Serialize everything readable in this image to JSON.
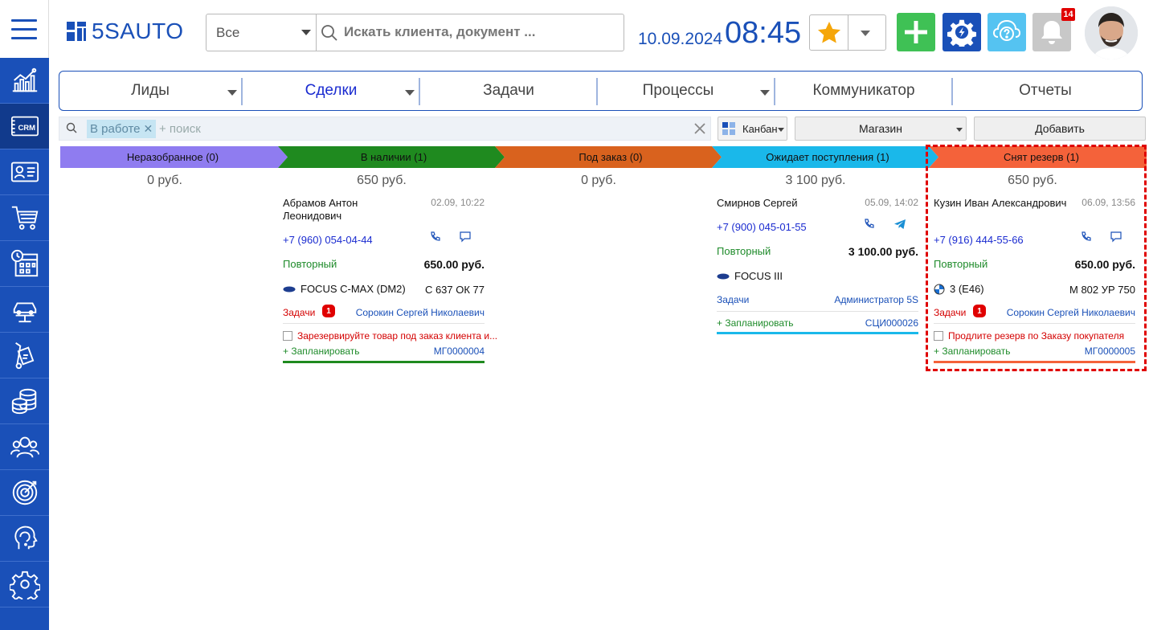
{
  "app": {
    "logo": "5SAUTO"
  },
  "header": {
    "search_scope": "Все",
    "search_placeholder": "Искать клиента, документ ...",
    "date": "10.09.2024",
    "time": "08:45",
    "notifications_count": "14"
  },
  "nav": {
    "tabs": [
      {
        "label": "Лиды"
      },
      {
        "label": "Сделки"
      },
      {
        "label": "Задачи"
      },
      {
        "label": "Процессы"
      },
      {
        "label": "Коммуникатор"
      },
      {
        "label": "Отчеты"
      }
    ],
    "active": "Сделки"
  },
  "filter": {
    "chip": "В работе",
    "placeholder": "+ поиск",
    "view_label": "Канбан",
    "shop_label": "Магазин",
    "add_label": "Добавить"
  },
  "colors": {
    "brand": "#1a50b8",
    "stage_unsorted": "#8f7cf0",
    "stage_instock": "#1f8a1f",
    "stage_order": "#d9621e",
    "stage_awaiting": "#1ab8ea",
    "stage_released": "#f4623a"
  },
  "stages": [
    {
      "title": "Неразобранное (0)",
      "sum": "0 руб."
    },
    {
      "title": "В наличии (1)",
      "sum": "650 руб."
    },
    {
      "title": "Под заказ (0)",
      "sum": "0 руб."
    },
    {
      "title": "Ожидает поступления (1)",
      "sum": "3 100 руб."
    },
    {
      "title": "Снят резерв (1)",
      "sum": "650 руб."
    }
  ],
  "cards": [
    {
      "name": "Абрамов Антон Леонидович",
      "date": "02.09, 10:22",
      "phone": "+7 (960) 054-04-44",
      "type": "Повторный",
      "amount": "650.00 руб.",
      "car": "FOCUS C-MAX (DM2)",
      "plate": "С 637 ОК 77",
      "tasks_label": "Задачи",
      "tasks_count": "1",
      "responsible": "Сорокин Сергей Николаевич",
      "task": "Зарезервируйте товар под заказ клиента и...",
      "plan": "+ Запланировать",
      "number": "МГ0000004"
    },
    {
      "name": "Смирнов Сергей",
      "date": "05.09, 14:02",
      "phone": "+7 (900) 045-01-55",
      "type": "Повторный",
      "amount": "3 100.00 руб.",
      "car": "FOCUS III",
      "tasks_label": "Задачи",
      "responsible": "Администратор 5S",
      "plan": "+ Запланировать",
      "number": "СЦИ000026"
    },
    {
      "name": "Кузин Иван Александрович",
      "date": "06.09, 13:56",
      "phone": "+7 (916) 444-55-66",
      "type": "Повторный",
      "amount": "650.00 руб.",
      "car": "3 (E46)",
      "plate": "М 802 УР 750",
      "tasks_label": "Задачи",
      "tasks_count": "1",
      "responsible": "Сорокин Сергей Николаевич",
      "task": "Продлите резерв по Заказу покупателя",
      "plan": "+ Запланировать",
      "number": "МГ0000005"
    }
  ],
  "sidebar_icons": [
    "chart-icon",
    "crm-icon",
    "contacts-icon",
    "cart-icon",
    "calendar-icon",
    "car-lift-icon",
    "parts-icon",
    "coins-icon",
    "team-icon",
    "target-icon",
    "support-icon",
    "gear-icon"
  ]
}
